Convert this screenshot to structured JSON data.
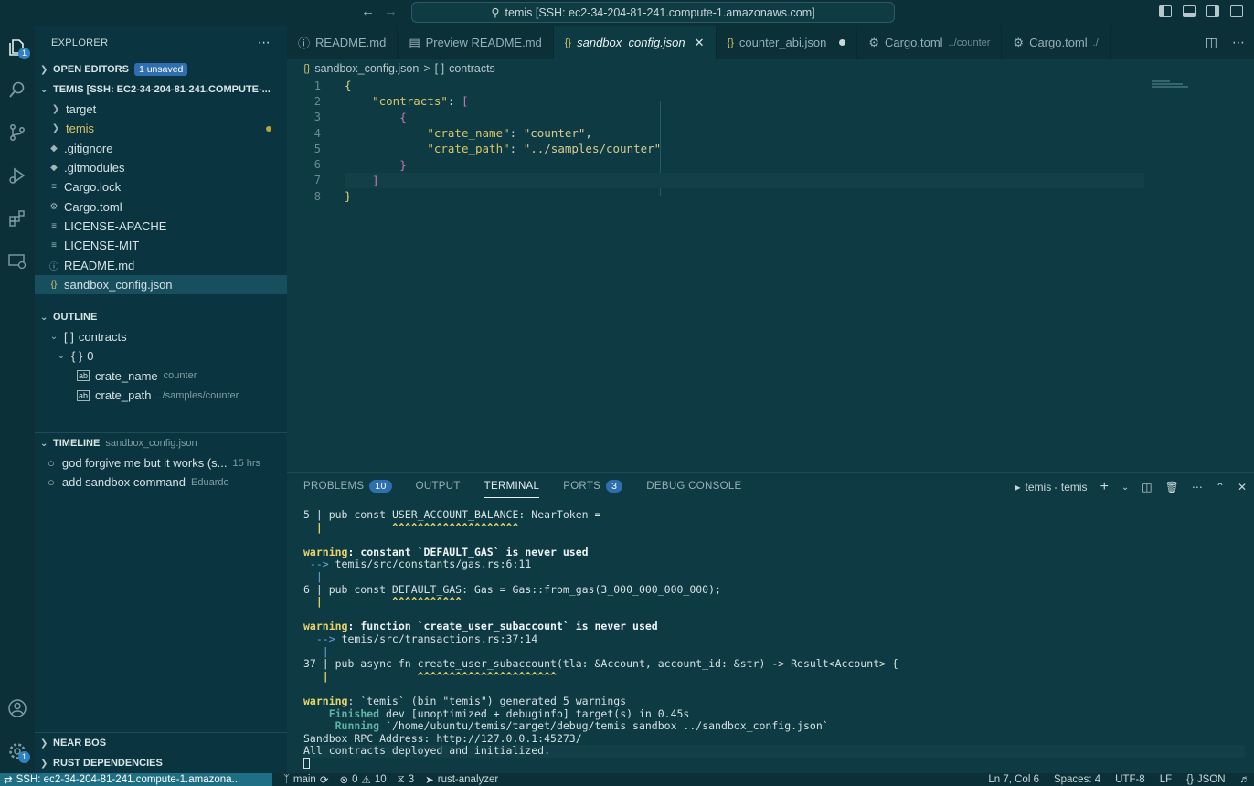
{
  "titlebar": {
    "search": "temis [SSH: ec2-34-204-81-241.compute-1.amazonaws.com]"
  },
  "activity": {
    "explorer_badge": "1",
    "settings_badge": "1"
  },
  "sidebar": {
    "title": "EXPLORER",
    "open_editors": {
      "label": "OPEN EDITORS",
      "badge": "1 unsaved"
    },
    "workspace": {
      "label": "TEMIS [SSH: EC2-34-204-81-241.COMPUTE-..."
    },
    "files": [
      {
        "name": "target",
        "kind": "folder"
      },
      {
        "name": "temis",
        "kind": "folder"
      },
      {
        "name": ".gitignore",
        "kind": "file"
      },
      {
        "name": ".gitmodules",
        "kind": "file"
      },
      {
        "name": "Cargo.lock",
        "kind": "file"
      },
      {
        "name": "Cargo.toml",
        "kind": "gear"
      },
      {
        "name": "LICENSE-APACHE",
        "kind": "file"
      },
      {
        "name": "LICENSE-MIT",
        "kind": "file"
      },
      {
        "name": "README.md",
        "kind": "info"
      },
      {
        "name": "sandbox_config.json",
        "kind": "json"
      }
    ],
    "outline": {
      "label": "OUTLINE",
      "contracts": "contracts",
      "index": "0",
      "crate_name": {
        "key": "crate_name",
        "value": "counter"
      },
      "crate_path": {
        "key": "crate_path",
        "value": "../samples/counter"
      }
    },
    "timeline": {
      "label": "TIMELINE",
      "file": "sandbox_config.json",
      "items": [
        {
          "msg": "god forgive me but it works (s...",
          "meta": "15 hrs"
        },
        {
          "msg": "add sandbox command",
          "meta": "Eduardo"
        }
      ]
    },
    "near_bos": "NEAR BOS",
    "rust_deps": "RUST DEPENDENCIES"
  },
  "tabs": [
    {
      "label": "README.md",
      "desc": ""
    },
    {
      "label": "Preview README.md",
      "desc": ""
    },
    {
      "label": "sandbox_config.json",
      "desc": ""
    },
    {
      "label": "counter_abi.json",
      "desc": ""
    },
    {
      "label": "Cargo.toml",
      "desc": "../counter"
    },
    {
      "label": "Cargo.toml",
      "desc": "./"
    }
  ],
  "breadcrumb": {
    "file": "sandbox_config.json",
    "sep": ">",
    "node": "contracts"
  },
  "editor": {
    "line_numbers": [
      "1",
      "2",
      "3",
      "4",
      "5",
      "6",
      "7",
      "8"
    ],
    "lines": [
      {
        "parts": [
          {
            "t": "{",
            "c": "br1"
          }
        ]
      },
      {
        "parts": [
          {
            "t": "    "
          },
          {
            "t": "\"contracts\"",
            "c": "k"
          },
          {
            "t": ": "
          },
          {
            "t": "[",
            "c": "br2"
          }
        ]
      },
      {
        "parts": [
          {
            "t": "        "
          },
          {
            "t": "{",
            "c": "br2"
          }
        ]
      },
      {
        "parts": [
          {
            "t": "            "
          },
          {
            "t": "\"crate_name\"",
            "c": "k"
          },
          {
            "t": ": "
          },
          {
            "t": "\"counter\"",
            "c": "s"
          },
          {
            "t": ","
          }
        ]
      },
      {
        "parts": [
          {
            "t": "            "
          },
          {
            "t": "\"crate_path\"",
            "c": "k"
          },
          {
            "t": ": "
          },
          {
            "t": "\"../samples/counter\"",
            "c": "s"
          }
        ]
      },
      {
        "parts": [
          {
            "t": "        "
          },
          {
            "t": "}",
            "c": "br2"
          }
        ]
      },
      {
        "parts": [
          {
            "t": "    "
          },
          {
            "t": "]",
            "c": "br2"
          }
        ]
      },
      {
        "parts": [
          {
            "t": "}",
            "c": "br1"
          }
        ]
      }
    ]
  },
  "panel": {
    "tabs": [
      {
        "label": "PROBLEMS",
        "badge": "10"
      },
      {
        "label": "OUTPUT",
        "badge": ""
      },
      {
        "label": "TERMINAL",
        "badge": ""
      },
      {
        "label": "PORTS",
        "badge": "3"
      },
      {
        "label": "DEBUG CONSOLE",
        "badge": ""
      }
    ],
    "terminal_name": "temis - temis",
    "terminal_lines": [
      [
        {
          "t": "5 | pub const "
        },
        {
          "t": "USER_ACCOUNT_BALANCE"
        },
        {
          "t": ": NearToken ="
        }
      ],
      [
        {
          "t": "  |           ^^^^^^^^^^^^^^^^^^^^",
          "c": "w"
        }
      ],
      [
        {
          "t": ""
        }
      ],
      [
        {
          "t": "warning",
          "c": "w"
        },
        {
          "t": ": constant `DEFAULT_GAS` is never used",
          "c": "b"
        }
      ],
      [
        {
          "t": " --> ",
          "c": "blue"
        },
        {
          "t": "temis/src/constants/gas.rs:6:11"
        }
      ],
      [
        {
          "t": "  |",
          "c": "blue"
        }
      ],
      [
        {
          "t": "6 | pub const DEFAULT_GAS: Gas = Gas::from_gas(3_000_000_000_000);"
        }
      ],
      [
        {
          "t": "  |           ^^^^^^^^^^^",
          "c": "w"
        }
      ],
      [
        {
          "t": ""
        }
      ],
      [
        {
          "t": "warning",
          "c": "w"
        },
        {
          "t": ": function `create_user_subaccount` is never used",
          "c": "b"
        }
      ],
      [
        {
          "t": "  --> ",
          "c": "blue"
        },
        {
          "t": "temis/src/transactions.rs:37:14"
        }
      ],
      [
        {
          "t": "   |",
          "c": "blue"
        }
      ],
      [
        {
          "t": "37 | pub async fn create_user_subaccount(tla: &Account, account_id: &str) -> Result<Account> {"
        }
      ],
      [
        {
          "t": "   |              ^^^^^^^^^^^^^^^^^^^^^^",
          "c": "w"
        }
      ],
      [
        {
          "t": ""
        }
      ],
      [
        {
          "t": "warning",
          "c": "w"
        },
        {
          "t": ": `temis` (bin \"temis\") generated 5 warnings"
        }
      ],
      [
        {
          "t": "    "
        },
        {
          "t": "Finished",
          "c": "g"
        },
        {
          "t": " dev [unoptimized + debuginfo] target(s) in 0.45s"
        }
      ],
      [
        {
          "t": "     "
        },
        {
          "t": "Running",
          "c": "g"
        },
        {
          "t": " `/home/ubuntu/temis/target/debug/temis sandbox ../sandbox_config.json`"
        }
      ],
      [
        {
          "t": "Sandbox RPC Address: http://127.0.0.1:45273/"
        }
      ],
      [
        {
          "t": "All contracts deployed and initialized."
        }
      ]
    ]
  },
  "statusbar": {
    "remote": "SSH: ec2-34-204-81-241.compute-1.amazona...",
    "branch": "main",
    "errors": "0",
    "warnings": "10",
    "ports": "3",
    "server": "rust-analyzer",
    "position": "Ln 7, Col 6",
    "spaces": "Spaces: 4",
    "encoding": "UTF-8",
    "eol": "LF",
    "language": "JSON"
  }
}
